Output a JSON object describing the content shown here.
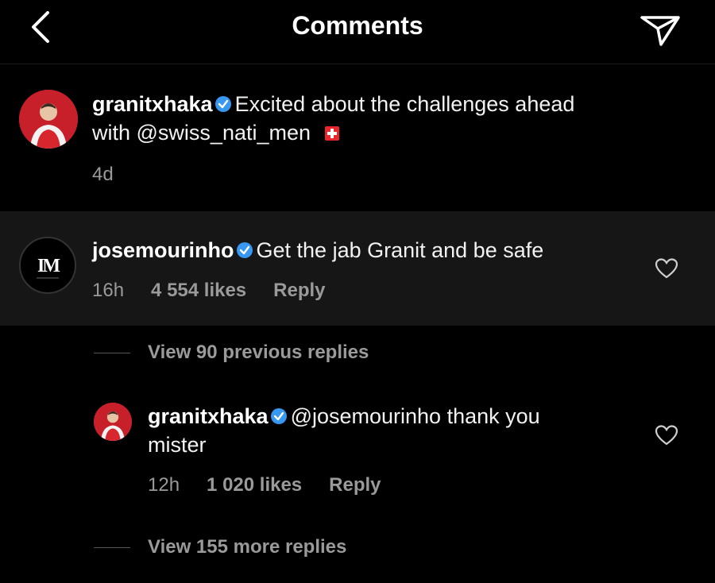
{
  "header": {
    "title": "Comments"
  },
  "caption": {
    "username": "granitxhaka",
    "text_line1": "Excited about the challenges ahead",
    "text_line2": "with @swiss_nati_men",
    "time": "4d"
  },
  "top_comment": {
    "username": "josemourinho",
    "text": "Get the jab Granit and be safe",
    "time": "16h",
    "likes": "4 554 likes",
    "reply_label": "Reply",
    "avatar_monogram": "IM"
  },
  "view_previous": {
    "label": "View 90 previous replies"
  },
  "reply": {
    "username": "granitxhaka",
    "text_line1": "@josemourinho thank you",
    "text_line2": "mister",
    "time": "12h",
    "likes": "1 020 likes",
    "reply_label": "Reply"
  },
  "view_more": {
    "label": "View 155 more replies"
  },
  "colors": {
    "background": "#000000",
    "highlight": "#161616",
    "muted": "#9a9a9a",
    "verified": "#3897f0",
    "avatar_red": "#d32630"
  }
}
